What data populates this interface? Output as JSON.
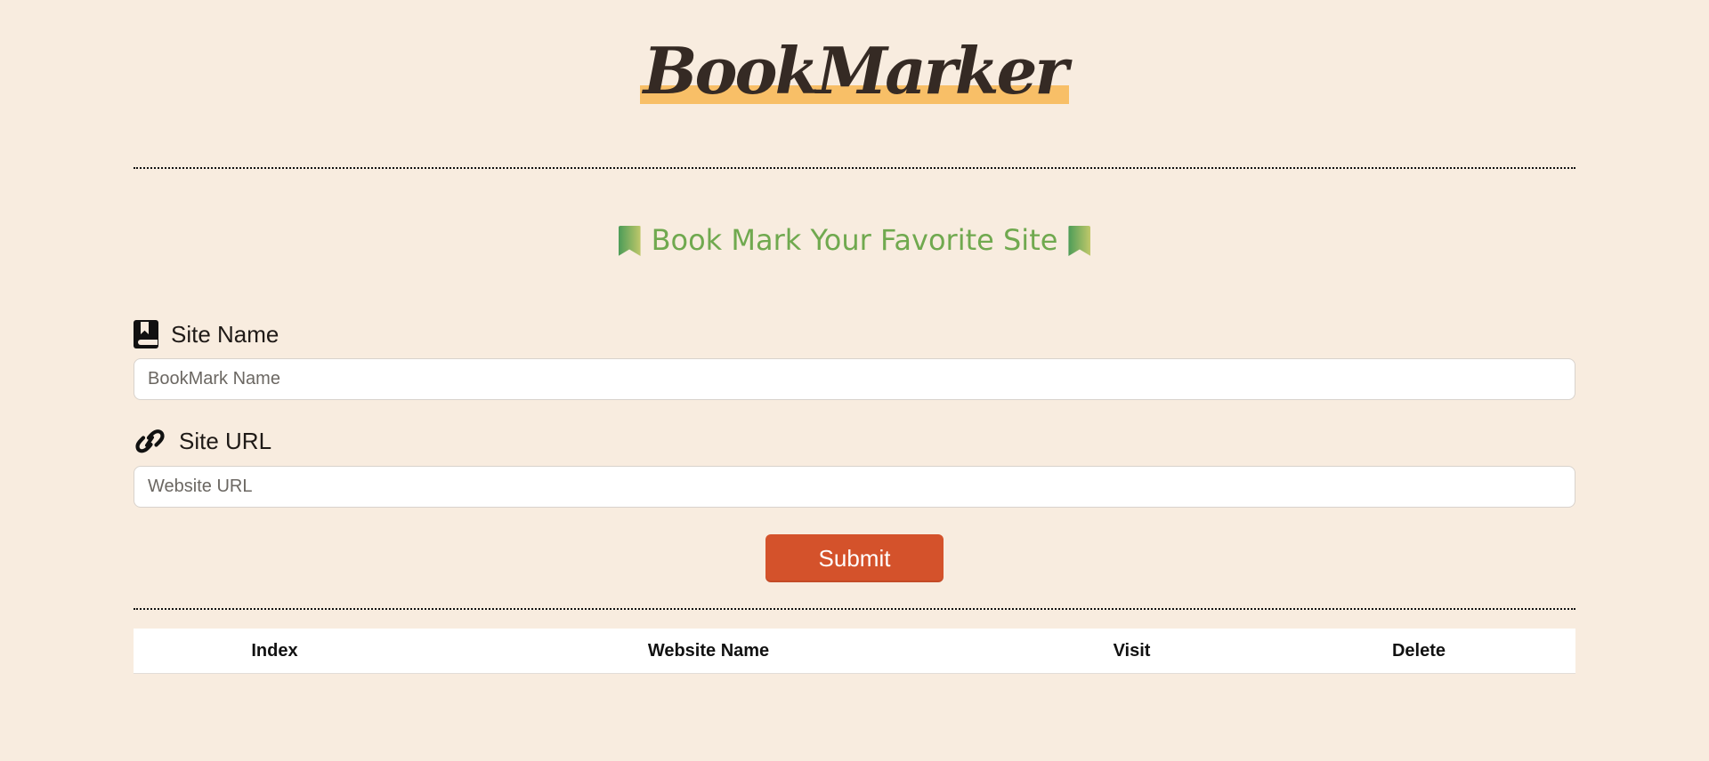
{
  "app": {
    "title": "BookMarker"
  },
  "subtitle": {
    "text": "Book Mark Your Favorite Site",
    "color": "#70a94f",
    "ribbon_icon": "bookmark-ribbon-icon"
  },
  "form": {
    "site_name": {
      "label": "Site Name",
      "icon": "book-icon",
      "placeholder": "BookMark Name",
      "value": ""
    },
    "site_url": {
      "label": "Site URL",
      "icon": "link-icon",
      "placeholder": "Website URL",
      "value": ""
    },
    "submit_label": "Submit",
    "submit_color": "#d4522b"
  },
  "table": {
    "columns": [
      "Index",
      "Website Name",
      "Visit",
      "Delete"
    ],
    "rows": []
  },
  "colors": {
    "background": "#f8ecdf",
    "brand_highlight": "#f8bf67",
    "brand_text": "#352a24"
  }
}
